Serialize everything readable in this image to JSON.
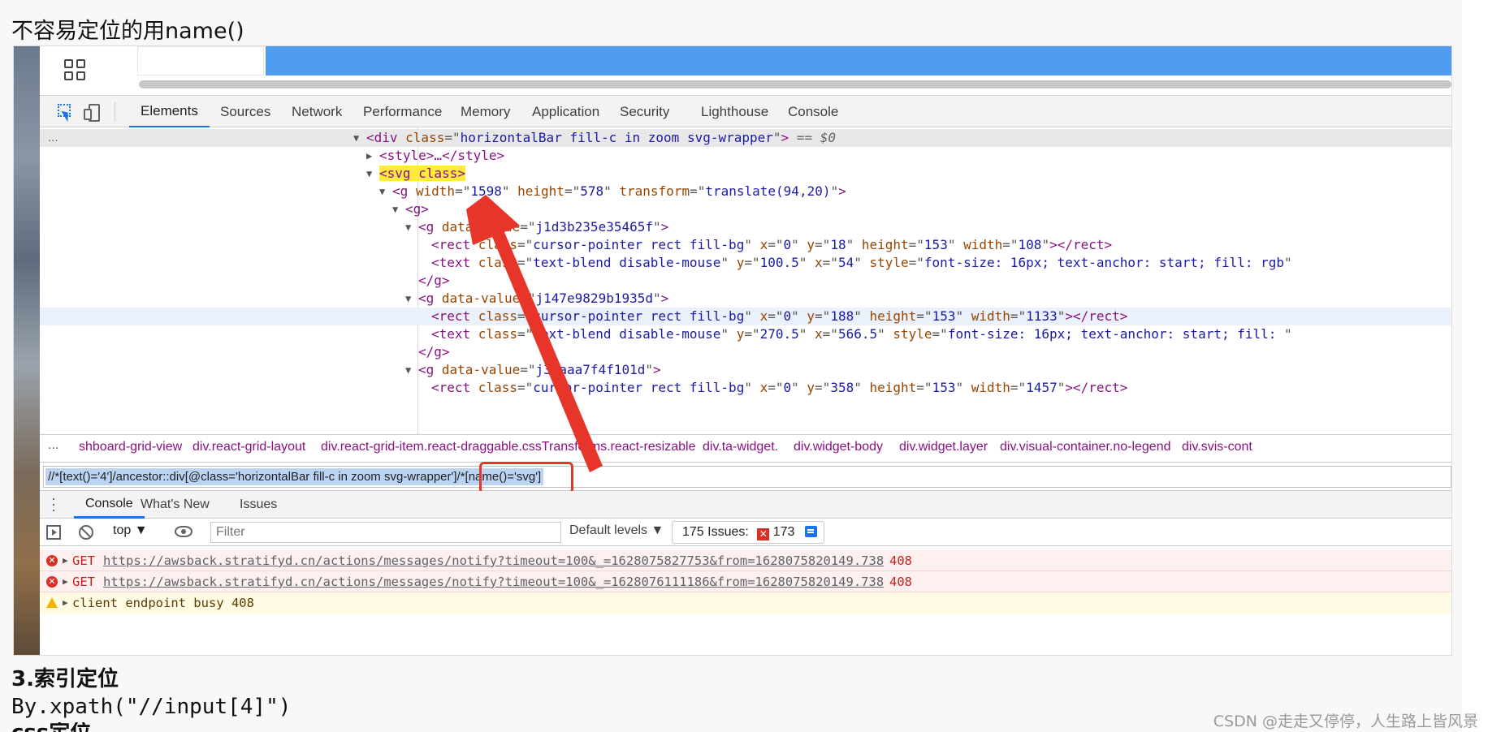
{
  "heading": "不容易定位的用name()",
  "devtools": {
    "tabs": [
      "Elements",
      "Sources",
      "Network",
      "Performance",
      "Memory",
      "Application",
      "Security",
      "Lighthouse",
      "Console"
    ],
    "active_tab": "Elements"
  },
  "elements_panel": {
    "ellipsis": "...",
    "lines": [
      {
        "indent": 0,
        "tri": "▼",
        "tag": "div",
        "attrs": [
          [
            "class",
            "horizontalBar fill-c in zoom svg-wrapper"
          ]
        ],
        "close": ">",
        "suffix": " == $0",
        "selected": true
      },
      {
        "indent": 1,
        "tri": "▶",
        "raw": "<style>…</style>"
      },
      {
        "indent": 1,
        "tri": "▼",
        "raw": "<svg class>",
        "highlight": true
      },
      {
        "indent": 2,
        "tri": "▼",
        "tag": "g",
        "attrs": [
          [
            "width",
            "1598"
          ],
          [
            "height",
            "578"
          ],
          [
            "transform",
            "translate(94,20)"
          ]
        ],
        "close": ">"
      },
      {
        "indent": 3,
        "tri": "▼",
        "raw": "<g>"
      },
      {
        "indent": 4,
        "tri": "▼",
        "tag": "g",
        "attrs": [
          [
            "data-value",
            "j1d3b235e35465f"
          ]
        ],
        "close": ">"
      },
      {
        "indent": 5,
        "tag": "rect",
        "attrs": [
          [
            "class",
            "cursor-pointer rect fill-bg"
          ],
          [
            "x",
            "0"
          ],
          [
            "y",
            "18"
          ],
          [
            "height",
            "153"
          ],
          [
            "width",
            "108"
          ]
        ],
        "close": "></rect>"
      },
      {
        "indent": 5,
        "tag": "text",
        "attrs": [
          [
            "class",
            "text-blend disable-mouse"
          ],
          [
            "y",
            "100.5"
          ],
          [
            "x",
            "54"
          ],
          [
            "style",
            "font-size: 16px; text-anchor: start; fill: rgb"
          ]
        ],
        "close": ""
      },
      {
        "indent": 4,
        "raw": "</g>"
      },
      {
        "indent": 4,
        "tri": "▼",
        "tag": "g",
        "attrs": [
          [
            "data-value",
            "j147e9829b1935d"
          ]
        ],
        "close": ">"
      },
      {
        "indent": 5,
        "tag": "rect",
        "attrs": [
          [
            "class",
            "cursor-pointer rect fill-bg"
          ],
          [
            "x",
            "0"
          ],
          [
            "y",
            "188"
          ],
          [
            "height",
            "153"
          ],
          [
            "width",
            "1133"
          ]
        ],
        "close": "></rect>",
        "hover": true
      },
      {
        "indent": 5,
        "tag": "text",
        "attrs": [
          [
            "class",
            "text-blend disable-mouse"
          ],
          [
            "y",
            "270.5"
          ],
          [
            "x",
            "566.5"
          ],
          [
            "style",
            "font-size: 16px; text-anchor: start; fill: "
          ]
        ],
        "close": ""
      },
      {
        "indent": 4,
        "raw": "</g>"
      },
      {
        "indent": 4,
        "tri": "▼",
        "tag": "g",
        "attrs": [
          [
            "data-value",
            "j38aaa7f4f101d"
          ]
        ],
        "close": ">"
      },
      {
        "indent": 5,
        "tag": "rect",
        "attrs": [
          [
            "class",
            "cursor-pointer rect fill-bg"
          ],
          [
            "x",
            "0"
          ],
          [
            "y",
            "358"
          ],
          [
            "height",
            "153"
          ],
          [
            "width",
            "1457"
          ]
        ],
        "close": "></rect>"
      }
    ]
  },
  "breadcrumbs": {
    "dots": "...",
    "items": [
      "shboard-grid-view",
      "div.react-grid-layout",
      "div.react-grid-item.react-draggable.cssTransforms.react-resizable",
      "div.ta-widget.",
      "div.widget-body",
      "div.widget.layer",
      "div.visual-container.no-legend",
      "div.svis-cont"
    ]
  },
  "search": {
    "xpath": "//*[text()='4']/ancestor::div[@class='horizontalBar fill-c in zoom svg-wrapper']/*[name()='svg']"
  },
  "console_drawer": {
    "tabs": [
      "Console",
      "What's New",
      "Issues"
    ],
    "active_tab": "Console",
    "context": "top ▼",
    "filter_placeholder": "Filter",
    "levels": "Default levels ▼",
    "issues_label": "175 Issues:",
    "issues_errors": "173",
    "issues_messages": "2"
  },
  "console_messages": [
    {
      "level": "error",
      "method": "GET",
      "url": "https://awsback.stratifyd.cn/actions/messages/notify?timeout=100&_=1628075827753&from=1628075820149.738",
      "status": "408"
    },
    {
      "level": "error",
      "method": "GET",
      "url": "https://awsback.stratifyd.cn/actions/messages/notify?timeout=100&_=1628076111186&from=1628075820149.738",
      "status": "408"
    },
    {
      "level": "warning",
      "text": "client endpoint busy 408"
    }
  ],
  "section": {
    "title": "3.索引定位",
    "code": "By.xpath(\"//input[4]\")",
    "next_partial": "css定位"
  },
  "watermark": "CSDN @走走又停停，人生路上皆风景",
  "colors": {
    "accent": "#1a73e8",
    "annotation_red": "#e8352a",
    "highlight_yellow": "#ffeb3b",
    "top_bar_blue": "#4e9bf0"
  }
}
